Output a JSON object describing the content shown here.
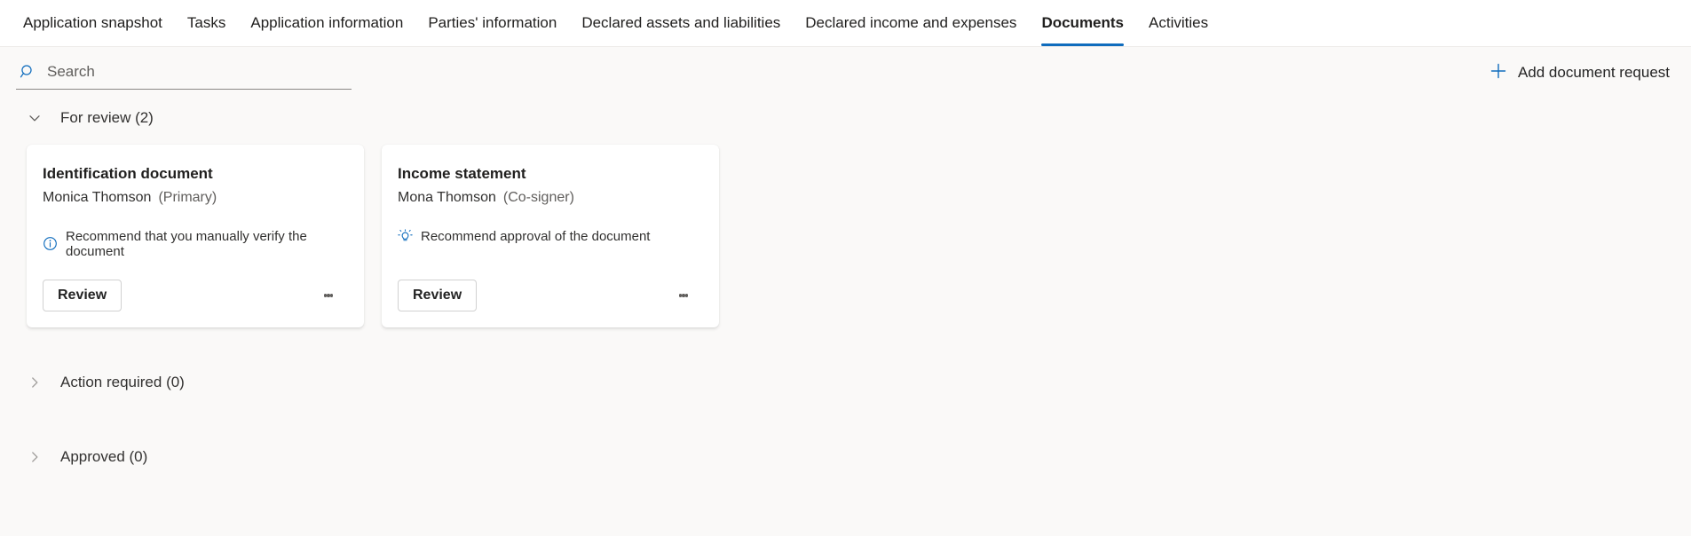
{
  "tabs": [
    {
      "label": "Application snapshot",
      "active": false
    },
    {
      "label": "Tasks",
      "active": false
    },
    {
      "label": "Application information",
      "active": false
    },
    {
      "label": "Parties' information",
      "active": false
    },
    {
      "label": "Declared assets and liabilities",
      "active": false
    },
    {
      "label": "Declared income and expenses",
      "active": false
    },
    {
      "label": "Documents",
      "active": true
    },
    {
      "label": "Activities",
      "active": false
    }
  ],
  "commandbar": {
    "search": {
      "placeholder": "Search",
      "value": "",
      "icon": "search-icon"
    },
    "add_document_request": {
      "label": "Add document request",
      "icon": "plus-icon"
    }
  },
  "sections": [
    {
      "title": "For review (2)",
      "expanded": true,
      "chevron": "chevron-down-icon",
      "cards": [
        {
          "title": "Identification document",
          "person": "Monica Thomson",
          "role": "(Primary)",
          "recommendation": "Recommend that you manually verify the document",
          "recommendation_icon": "info-icon",
          "primary_action": "Review",
          "overflow": "more-options-icon"
        },
        {
          "title": "Income statement",
          "person": "Mona Thomson",
          "role": "(Co-signer)",
          "recommendation": "Recommend approval of the document",
          "recommendation_icon": "lightbulb-icon",
          "primary_action": "Review",
          "overflow": "more-options-icon"
        }
      ]
    },
    {
      "title": "Action required (0)",
      "expanded": false,
      "chevron": "chevron-right-icon",
      "cards": []
    },
    {
      "title": "Approved (0)",
      "expanded": false,
      "chevron": "chevron-right-icon",
      "cards": []
    }
  ],
  "colors": {
    "accent": "#0f6cbd",
    "page_bg": "#faf9f8",
    "card_bg": "#ffffff",
    "tabbar_bg": "#ffffff",
    "text_primary": "#201f1e",
    "text_secondary": "#605e5c"
  }
}
